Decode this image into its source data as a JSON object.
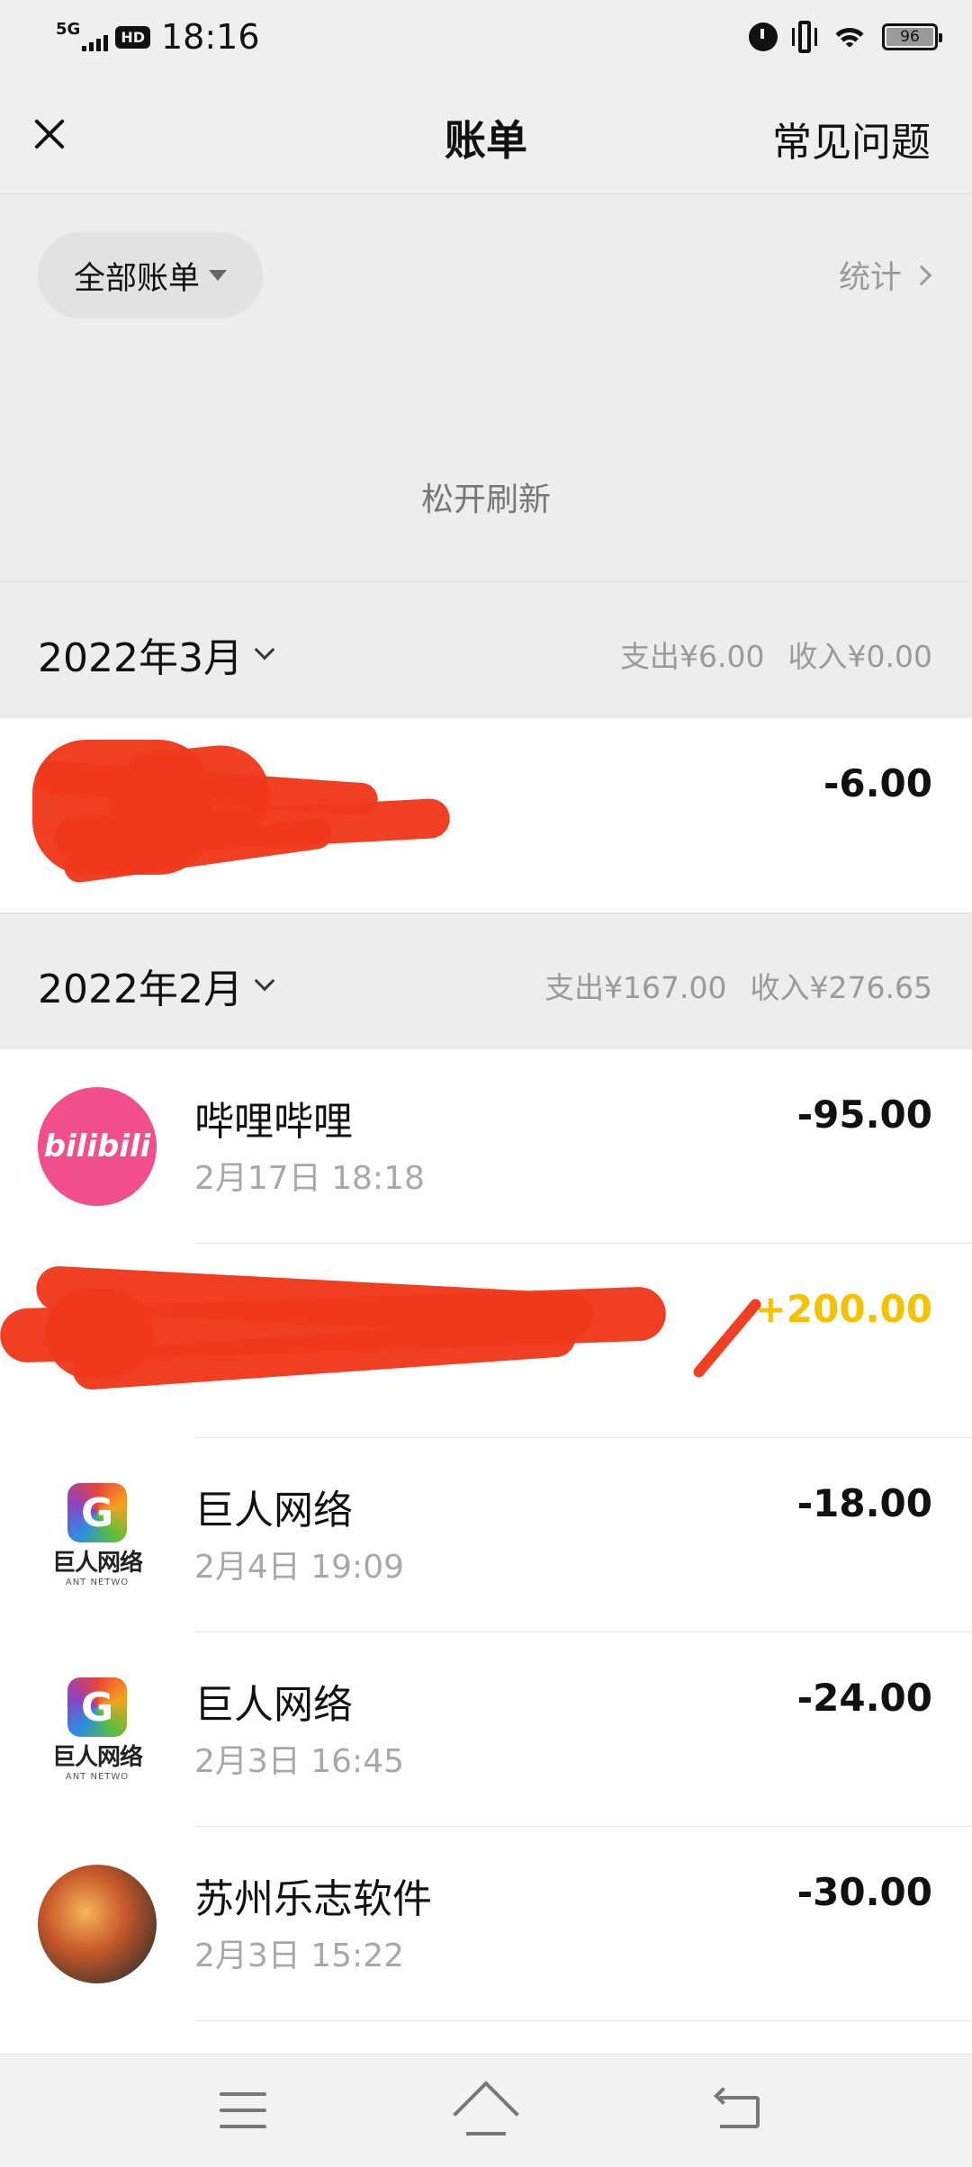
{
  "status_bar": {
    "network": "5G",
    "hd": "HD",
    "time": "18:16",
    "battery": "96"
  },
  "nav": {
    "title": "账单",
    "faq_label": "常见问题"
  },
  "filter": {
    "selected": "全部账单",
    "stats_label": "统计"
  },
  "pull_refresh_text": "松开刷新",
  "months": [
    {
      "label": "2022年3月",
      "expense": "支出¥6.00",
      "income": "收入¥0.00",
      "transactions": [
        {
          "name": "",
          "time": "",
          "amount": "-6.00",
          "icon": "redacted-icon"
        }
      ]
    },
    {
      "label": "2022年2月",
      "expense": "支出¥167.00",
      "income": "收入¥276.65",
      "transactions": [
        {
          "name": "哔哩哔哩",
          "time": "2月17日 18:18",
          "amount": "-95.00",
          "icon": "bilibili-icon",
          "icon_text": "bilibili"
        },
        {
          "name": "",
          "time": "",
          "amount": "+200.00",
          "icon": "redacted-icon"
        },
        {
          "name": "巨人网络",
          "time": "2月4日 19:09",
          "amount": "-18.00",
          "icon": "giant-network-icon",
          "icon_text": "巨人网络",
          "icon_subtext": "ANT NETWO"
        },
        {
          "name": "巨人网络",
          "time": "2月3日 16:45",
          "amount": "-24.00",
          "icon": "giant-network-icon",
          "icon_text": "巨人网络",
          "icon_subtext": "ANT NETWO"
        },
        {
          "name": "苏州乐志软件",
          "time": "2月3日 15:22",
          "amount": "-30.00",
          "icon": "warrior-game-icon"
        }
      ]
    }
  ],
  "colors": {
    "income": "#f3c200",
    "redaction": "#f0391c",
    "bilibili": "#f04f8b"
  },
  "bottom_nav": {
    "menu": "menu-icon",
    "home": "home-icon",
    "back": "back-icon"
  }
}
